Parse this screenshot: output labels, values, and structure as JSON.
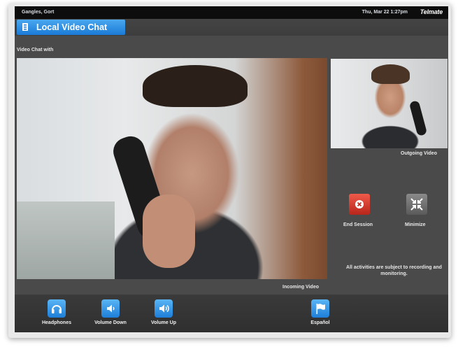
{
  "status_bar": {
    "user": "Gangles, Gort",
    "datetime": "Thu, Mar 22   1:27pm",
    "brand": "Telmate"
  },
  "window": {
    "title": "Local Video Chat",
    "subtitle": "Video Chat with"
  },
  "videos": {
    "incoming_label": "Incoming Video",
    "outgoing_label": "Outgoing Video"
  },
  "actions": {
    "end_session": "End Session",
    "minimize": "Minimize",
    "notice": "All activities are subject to recording and monitoring."
  },
  "toolbar": {
    "headphones": "Headphones",
    "volume_down": "Volume Down",
    "volume_up": "Volume Up",
    "language": "Español"
  },
  "colors": {
    "accent_blue": "#1a7ad6",
    "end_red": "#d8372a",
    "background": "#4a4a4a"
  }
}
